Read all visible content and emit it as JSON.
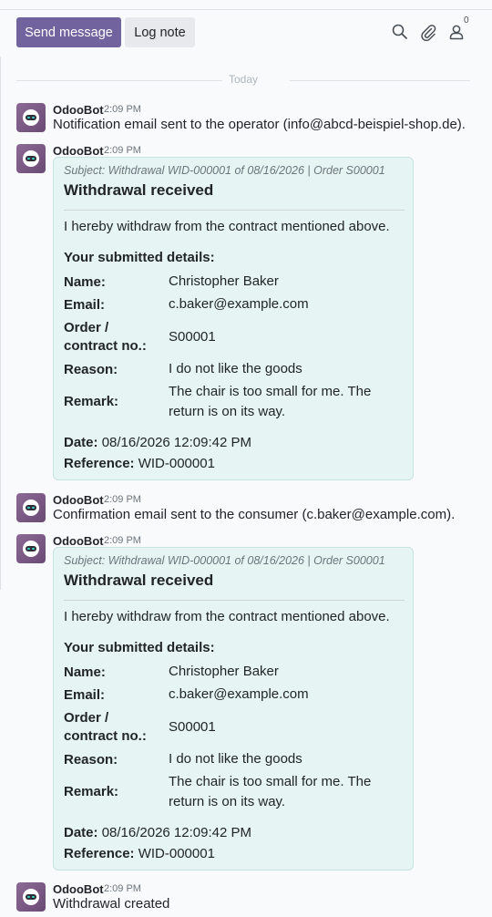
{
  "toolbar": {
    "send_message": "Send message",
    "log_note": "Log note",
    "follower_count": "0",
    "icons": [
      "search-icon",
      "paperclip-icon",
      "user-icon"
    ]
  },
  "date_separator": "Today",
  "colors": {
    "primary": "#71639e",
    "bubble_bg": "#e6f4f3",
    "bubble_border": "#c6e4e1"
  },
  "messages": [
    {
      "author": "OdooBot",
      "time": "2:09 PM",
      "text": "Notification email sent to the operator (info@abcd-beispiel-shop.de)."
    },
    {
      "author": "OdooBot",
      "time": "2:09 PM",
      "email": {
        "subject": "Subject: Withdrawal WID-000001 of 08/16/2026 | Order S00001",
        "title": "Withdrawal received",
        "intro": "I hereby withdraw from the contract mentioned above.",
        "details_heading": "Your submitted details:",
        "rows": [
          {
            "label": "Name:",
            "value": "Christopher Baker"
          },
          {
            "label": "Email:",
            "value": "c.baker@example.com"
          },
          {
            "label": "Order / contract no.:",
            "value": "S00001"
          },
          {
            "label": "Reason:",
            "value": "I do not like the goods"
          },
          {
            "label": "Remark:",
            "value": "The chair is too small for me. The return is on its way."
          }
        ],
        "date_label": "Date:",
        "date_value": "08/16/2026 12:09:42 PM",
        "reference_label": "Reference:",
        "reference_value": "WID-000001"
      }
    },
    {
      "author": "OdooBot",
      "time": "2:09 PM",
      "text": "Confirmation email sent to the consumer (c.baker@example.com)."
    },
    {
      "author": "OdooBot",
      "time": "2:09 PM",
      "email": {
        "subject": "Subject: Withdrawal WID-000001 of 08/16/2026 | Order S00001",
        "title": "Withdrawal received",
        "intro": "I hereby withdraw from the contract mentioned above.",
        "details_heading": "Your submitted details:",
        "rows": [
          {
            "label": "Name:",
            "value": "Christopher Baker"
          },
          {
            "label": "Email:",
            "value": "c.baker@example.com"
          },
          {
            "label": "Order / contract no.:",
            "value": "S00001"
          },
          {
            "label": "Reason:",
            "value": "I do not like the goods"
          },
          {
            "label": "Remark:",
            "value": "The chair is too small for me. The return is on its way."
          }
        ],
        "date_label": "Date:",
        "date_value": "08/16/2026 12:09:42 PM",
        "reference_label": "Reference:",
        "reference_value": "WID-000001"
      }
    },
    {
      "author": "OdooBot",
      "time": "2:09 PM",
      "text": "Withdrawal created"
    }
  ]
}
